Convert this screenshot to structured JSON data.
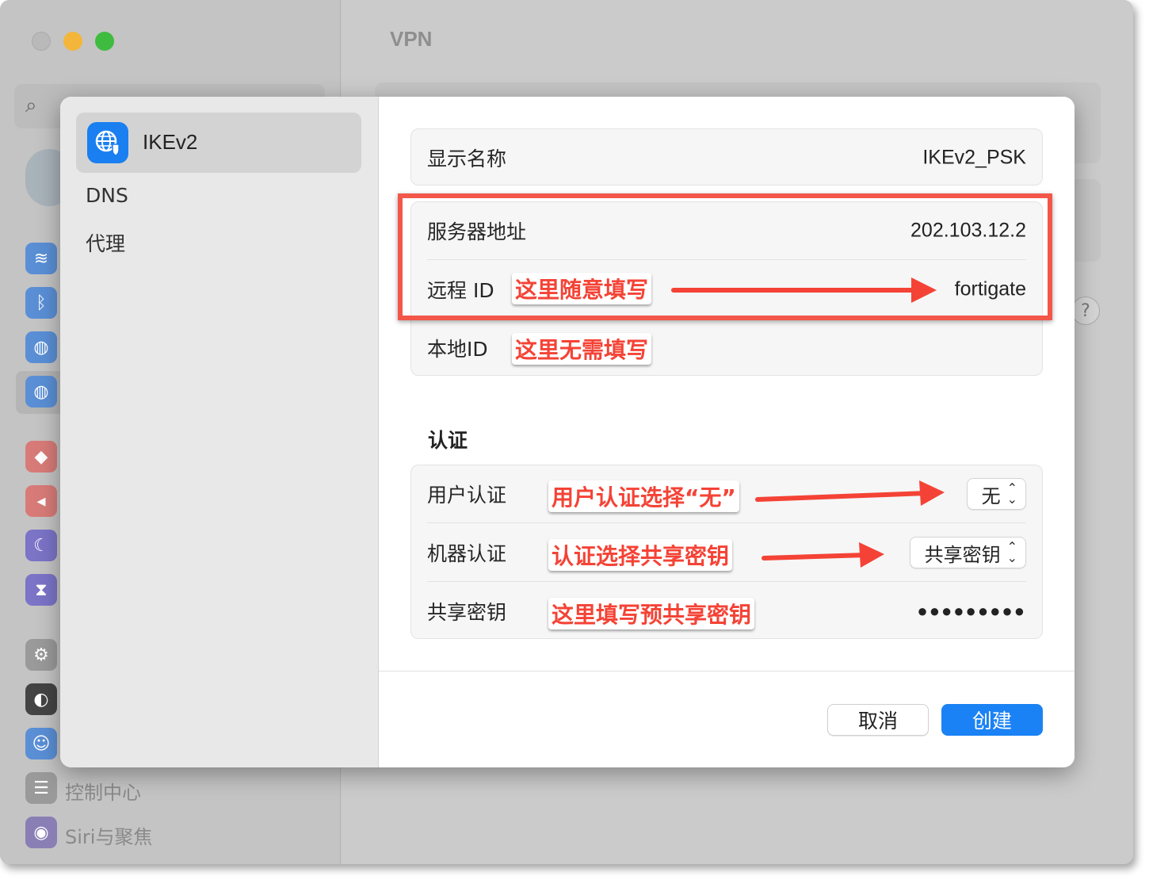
{
  "background": {
    "title": "VPN",
    "sidebar_labels": [
      "控制中心",
      "Siri与聚焦"
    ]
  },
  "dialog": {
    "sidebar": {
      "selected": "IKEv2",
      "items": [
        "DNS",
        "代理"
      ]
    },
    "general": {
      "display_name_label": "显示名称",
      "display_name_value": "IKEv2_PSK",
      "server_label": "服务器地址",
      "server_value": "202.103.12.2",
      "remote_id_label": "远程 ID",
      "remote_id_value": "fortigate",
      "local_id_label": "本地ID",
      "local_id_value": ""
    },
    "auth": {
      "section_title": "认证",
      "user_auth_label": "用户认证",
      "user_auth_value": "无",
      "machine_auth_label": "机器认证",
      "machine_auth_value": "共享密钥",
      "shared_secret_label": "共享密钥",
      "shared_secret_value": "●●●●●●●●●"
    },
    "buttons": {
      "cancel": "取消",
      "create": "创建"
    }
  },
  "annotations": {
    "remote_id_note": "这里随意填写",
    "local_id_note": "这里无需填写",
    "user_auth_note": "用户认证选择“无”",
    "machine_auth_note": "认证选择共享密钥",
    "shared_secret_note": "这里填写预共享密钥"
  },
  "colors": {
    "accent": "#1a82f4",
    "annotation": "#f44336"
  }
}
